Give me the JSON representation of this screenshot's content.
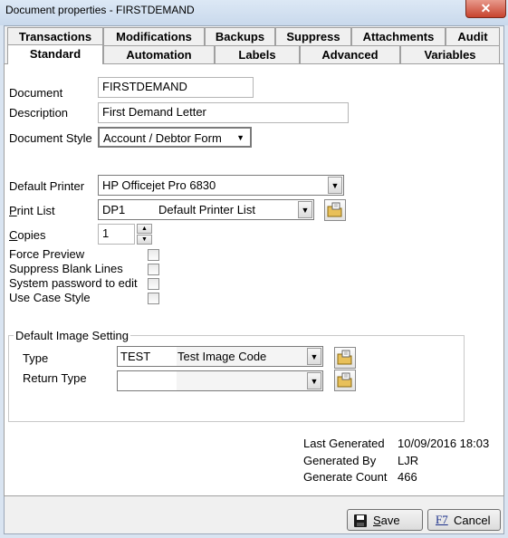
{
  "window": {
    "title": "Document properties - FIRSTDEMAND",
    "close_symbol": "✕"
  },
  "tabs": {
    "row1": [
      "Transactions",
      "Modifications",
      "Backups",
      "Suppress",
      "Attachments",
      "Audit"
    ],
    "row2": [
      "Standard",
      "Automation",
      "Labels",
      "Advanced",
      "Variables"
    ],
    "active": "Standard"
  },
  "form": {
    "document_label": "Document",
    "document_value": "FIRSTDEMAND",
    "description_label": "Description",
    "description_value": "First Demand Letter",
    "document_style_label": "Document Style",
    "document_style_value": "Account / Debtor Form",
    "default_printer_label": "Default Printer",
    "default_printer_value": "HP Officejet Pro 6830",
    "print_list_label": "Print List",
    "print_list_label_accel": "P",
    "print_list_label_rest": "rint List",
    "print_list_code": "DP1",
    "print_list_name": "Default Printer List",
    "copies_label_accel": "C",
    "copies_label_rest": "opies",
    "copies_value": "1",
    "force_preview_label": "Force Preview",
    "suppress_blank_label": "Suppress Blank Lines",
    "system_password_label": "System password to edit",
    "use_case_style_label": "Use Case Style"
  },
  "image_setting": {
    "legend": "Default Image Setting",
    "type_label": "Type",
    "type_code": "TEST",
    "type_name": "Test Image Code",
    "return_type_label": "Return Type",
    "return_type_code": "",
    "return_type_name": ""
  },
  "info": {
    "last_generated_label": "Last Generated",
    "last_generated_value": "10/09/2016 18:03",
    "generated_by_label": "Generated By",
    "generated_by_value": "LJR",
    "generate_count_label": "Generate Count",
    "generate_count_value": "466"
  },
  "buttons": {
    "save_accel": "S",
    "save_rest": "ave",
    "cancel_key": "F7",
    "cancel_label": "Cancel"
  },
  "icons": {
    "dropdown": "chevron-down-icon",
    "spinner_up": "triangle-up-icon",
    "spinner_down": "triangle-down-icon",
    "lookup": "folder-lookup-icon",
    "save": "floppy-disk-icon"
  }
}
